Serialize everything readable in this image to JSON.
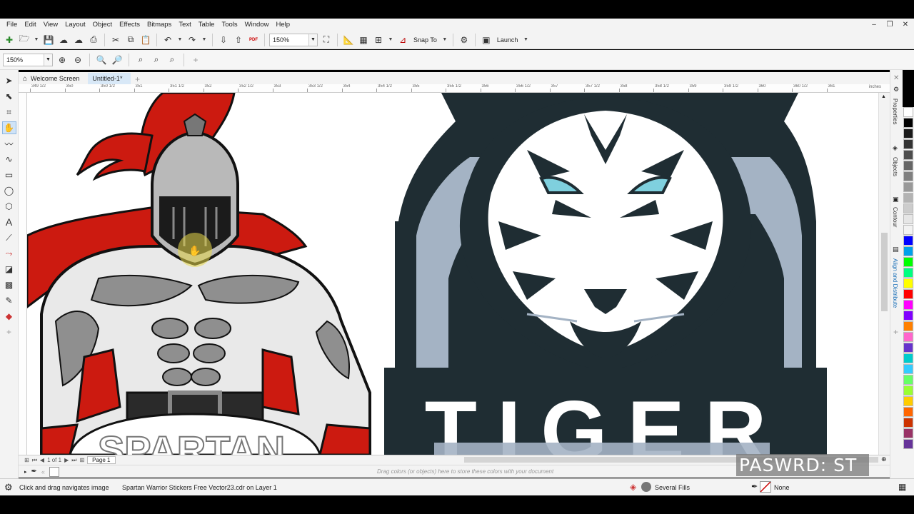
{
  "menu": [
    "File",
    "Edit",
    "View",
    "Layout",
    "Object",
    "Effects",
    "Bitmaps",
    "Text",
    "Table",
    "Tools",
    "Window",
    "Help"
  ],
  "toolbar": {
    "zoom_value": "150%",
    "snap_label": "Snap To",
    "launch_label": "Launch",
    "pdf_label": "PDF"
  },
  "propbar": {
    "zoom_value": "150%"
  },
  "tabs": [
    {
      "label": "Welcome Screen"
    },
    {
      "label": "Untitled-1*"
    }
  ],
  "ruler": {
    "units": "inches",
    "ticks": [
      "349 1/2",
      "350",
      "350 1/2",
      "351",
      "351 1/2",
      "352",
      "352 1/2",
      "353",
      "353 1/2",
      "354",
      "354 1/2",
      "355",
      "355 1/2",
      "356",
      "356 1/2",
      "357",
      "357 1/2",
      "358",
      "358 1/2",
      "359",
      "359 1/2",
      "360",
      "360 1/2",
      "361"
    ]
  },
  "artwork": {
    "tiger_text": "TIGER",
    "spartan_text": "SPARTAN"
  },
  "page_nav": {
    "count": "1 of 1",
    "page_label": "Page 1"
  },
  "color_strip": {
    "hint": "Drag colors (or objects) here to store these colors with your document"
  },
  "dockers": [
    "Properties",
    "Objects",
    "Contour",
    "Align and Distribute"
  ],
  "status": {
    "hint": "Click and drag navigates image",
    "file_info": "Spartan Warrior Stickers Free Vector23.cdr on Layer 1",
    "fill": "Several Fills",
    "outline": "None"
  },
  "overlay": {
    "password_text": "PASWRD:  ST"
  },
  "palette": [
    "#ffffff",
    "#000000",
    "#1a1a1a",
    "#333333",
    "#4d4d4d",
    "#666666",
    "#808080",
    "#999999",
    "#b3b3b3",
    "#cccccc",
    "#e6e6e6",
    "#f2f2f2",
    "#0000ff",
    "#00a0e9",
    "#00ff00",
    "#00ff80",
    "#ffff00",
    "#ff0000",
    "#ff00ff",
    "#8000ff",
    "#ff8000",
    "#ff66cc",
    "#6633cc",
    "#00cccc",
    "#33ccff",
    "#66ff66",
    "#99ff33",
    "#ffcc00",
    "#ff6600",
    "#cc3300",
    "#993366",
    "#663399"
  ],
  "colors": {
    "tiger_dark": "#1f2d33",
    "tiger_light": "#a4b3c4",
    "tiger_eye": "#7fd0de",
    "spartan_red": "#cc1a10"
  }
}
